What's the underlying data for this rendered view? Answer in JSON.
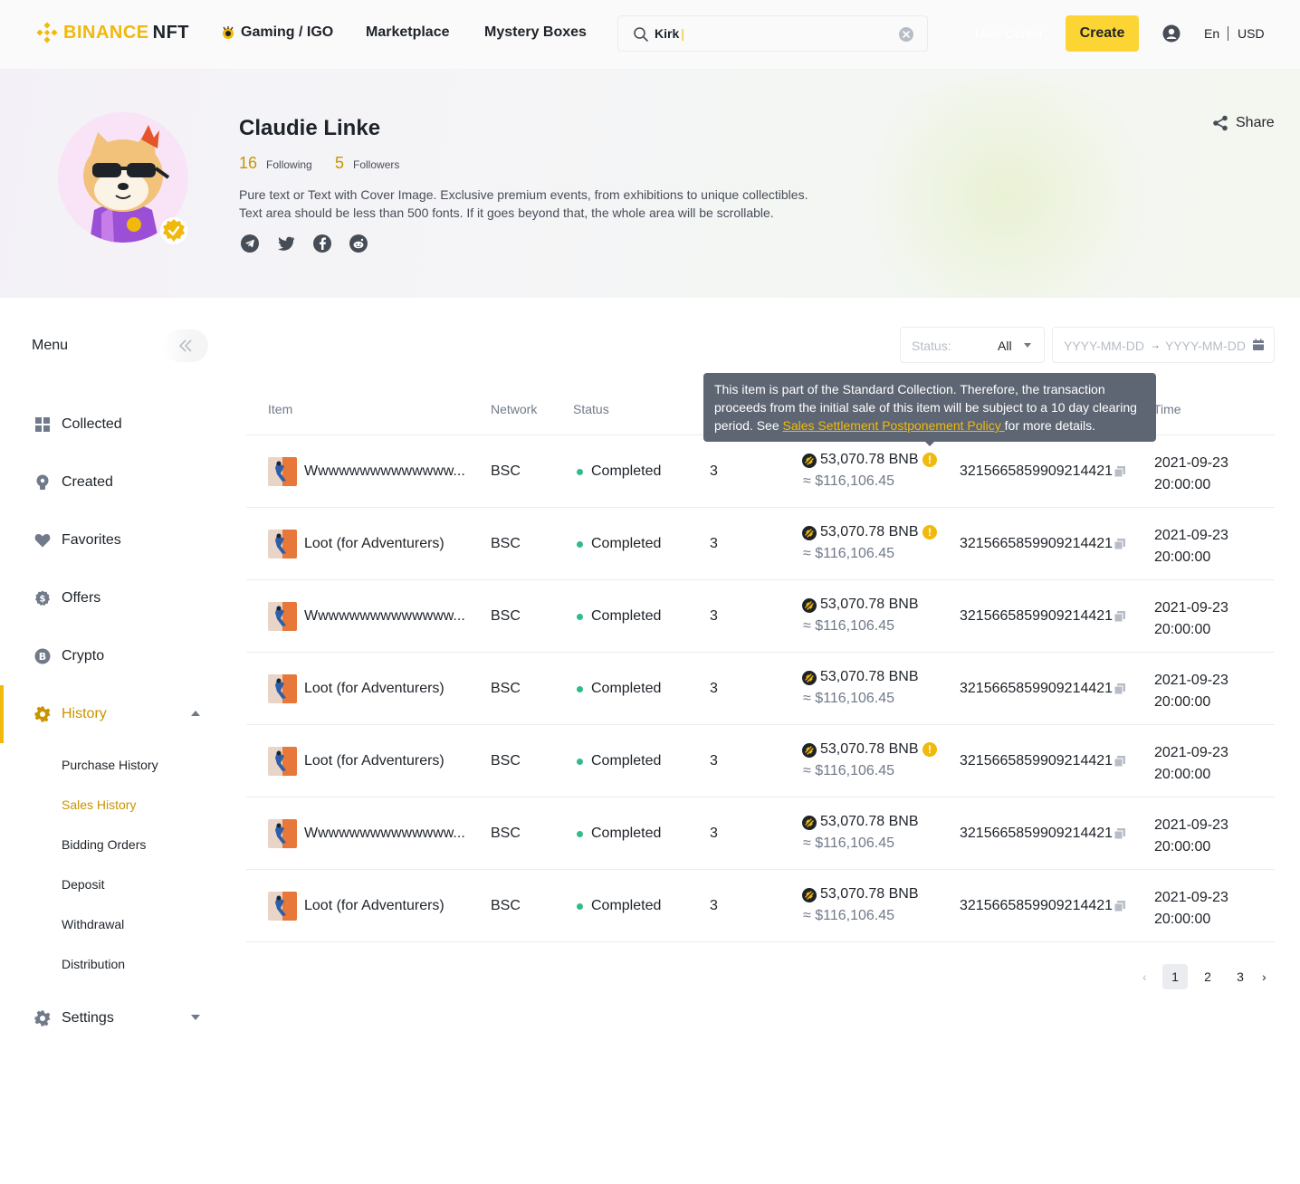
{
  "header": {
    "logo_brand": "BINANCE",
    "logo_suffix": "NFT",
    "nav": [
      {
        "label": "Gaming / IGO",
        "icon": "gaming-icon"
      },
      {
        "label": "Marketplace"
      },
      {
        "label": "Mystery Boxes"
      }
    ],
    "search_value": "Kirk",
    "user_center_label": "User Center",
    "create_label": "Create",
    "language": "En",
    "currency": "USD"
  },
  "profile": {
    "name": "Claudie Linke",
    "following_count": "16",
    "following_label": "Following",
    "followers_count": "5",
    "followers_label": "Followers",
    "bio_line1": "Pure text or Text with Cover Image. Exclusive premium events, from exhibitions to unique collectibles.",
    "bio_line2": "Text area should be less than 500 fonts. If it goes beyond that, the whole area will be scrollable.",
    "socials": [
      "telegram-icon",
      "twitter-icon",
      "facebook-icon",
      "reddit-icon"
    ],
    "share_label": "Share"
  },
  "sidebar": {
    "title": "Menu",
    "items": [
      {
        "label": "Collected",
        "icon": "grid-icon"
      },
      {
        "label": "Created",
        "icon": "bulb-icon"
      },
      {
        "label": "Favorites",
        "icon": "heart-icon"
      },
      {
        "label": "Offers",
        "icon": "dollar-icon"
      },
      {
        "label": "Crypto",
        "icon": "bitcoin-icon"
      },
      {
        "label": "History",
        "icon": "gear-icon",
        "active": true,
        "expanded": true
      },
      {
        "label": "Settings",
        "icon": "gear-icon",
        "expanded": false
      }
    ],
    "history_sub": [
      {
        "label": "Purchase History"
      },
      {
        "label": "Sales History",
        "active": true
      },
      {
        "label": "Bidding Orders"
      },
      {
        "label": "Deposit"
      },
      {
        "label": "Withdrawal"
      },
      {
        "label": "Distribution"
      }
    ]
  },
  "filters": {
    "status_label": "Status:",
    "status_value": "All",
    "date_start_placeholder": "YYYY-MM-DD",
    "date_end_placeholder": "YYYY-MM-DD"
  },
  "table": {
    "columns": [
      "Item",
      "Network",
      "Status",
      "Time"
    ],
    "rows": [
      {
        "item": "Wwwwwwwwwwwwww...",
        "network": "BSC",
        "status": "Completed",
        "qty": "3",
        "price": "53,070.78 BNB",
        "fiat": "≈ $116,106.45",
        "warning": true,
        "txid": "3215665859909214421",
        "date": "2021-09-23",
        "time": "20:00:00"
      },
      {
        "item": "Loot (for Adventurers)",
        "network": "BSC",
        "status": "Completed",
        "qty": "3",
        "price": "53,070.78 BNB",
        "fiat": "≈ $116,106.45",
        "warning": true,
        "txid": "3215665859909214421",
        "date": "2021-09-23",
        "time": "20:00:00"
      },
      {
        "item": "Wwwwwwwwwwwwww...",
        "network": "BSC",
        "status": "Completed",
        "qty": "3",
        "price": "53,070.78 BNB",
        "fiat": "≈ $116,106.45",
        "warning": false,
        "txid": "3215665859909214421",
        "date": "2021-09-23",
        "time": "20:00:00"
      },
      {
        "item": "Loot (for Adventurers)",
        "network": "BSC",
        "status": "Completed",
        "qty": "3",
        "price": "53,070.78 BNB",
        "fiat": "≈ $116,106.45",
        "warning": false,
        "txid": "3215665859909214421",
        "date": "2021-09-23",
        "time": "20:00:00"
      },
      {
        "item": "Loot (for Adventurers)",
        "network": "BSC",
        "status": "Completed",
        "qty": "3",
        "price": "53,070.78 BNB",
        "fiat": "≈ $116,106.45",
        "warning": true,
        "txid": "3215665859909214421",
        "date": "2021-09-23",
        "time": "20:00:00"
      },
      {
        "item": "Wwwwwwwwwwwwww...",
        "network": "BSC",
        "status": "Completed",
        "qty": "3",
        "price": "53,070.78 BNB",
        "fiat": "≈ $116,106.45",
        "warning": false,
        "txid": "3215665859909214421",
        "date": "2021-09-23",
        "time": "20:00:00"
      },
      {
        "item": "Loot (for Adventurers)",
        "network": "BSC",
        "status": "Completed",
        "qty": "3",
        "price": "53,070.78 BNB",
        "fiat": "≈ $116,106.45",
        "warning": false,
        "txid": "3215665859909214421",
        "date": "2021-09-23",
        "time": "20:00:00"
      }
    ]
  },
  "tooltip": {
    "text_before": "This item is part of the Standard Collection. Therefore, the transaction proceeds from the initial sale of this item will be subject to a 10 day clearing period. See ",
    "link": "Sales Settlement Postponement Policy ",
    "text_after": "for more details."
  },
  "pagination": {
    "pages": [
      "1",
      "2",
      "3"
    ],
    "current": "1",
    "prev": "‹",
    "next": "›"
  },
  "colors": {
    "brand": "#f0b90b",
    "button": "#fcd535",
    "active_text": "#c99400",
    "status_dot": "#2ebd85",
    "tooltip_bg": "#5e6673"
  }
}
